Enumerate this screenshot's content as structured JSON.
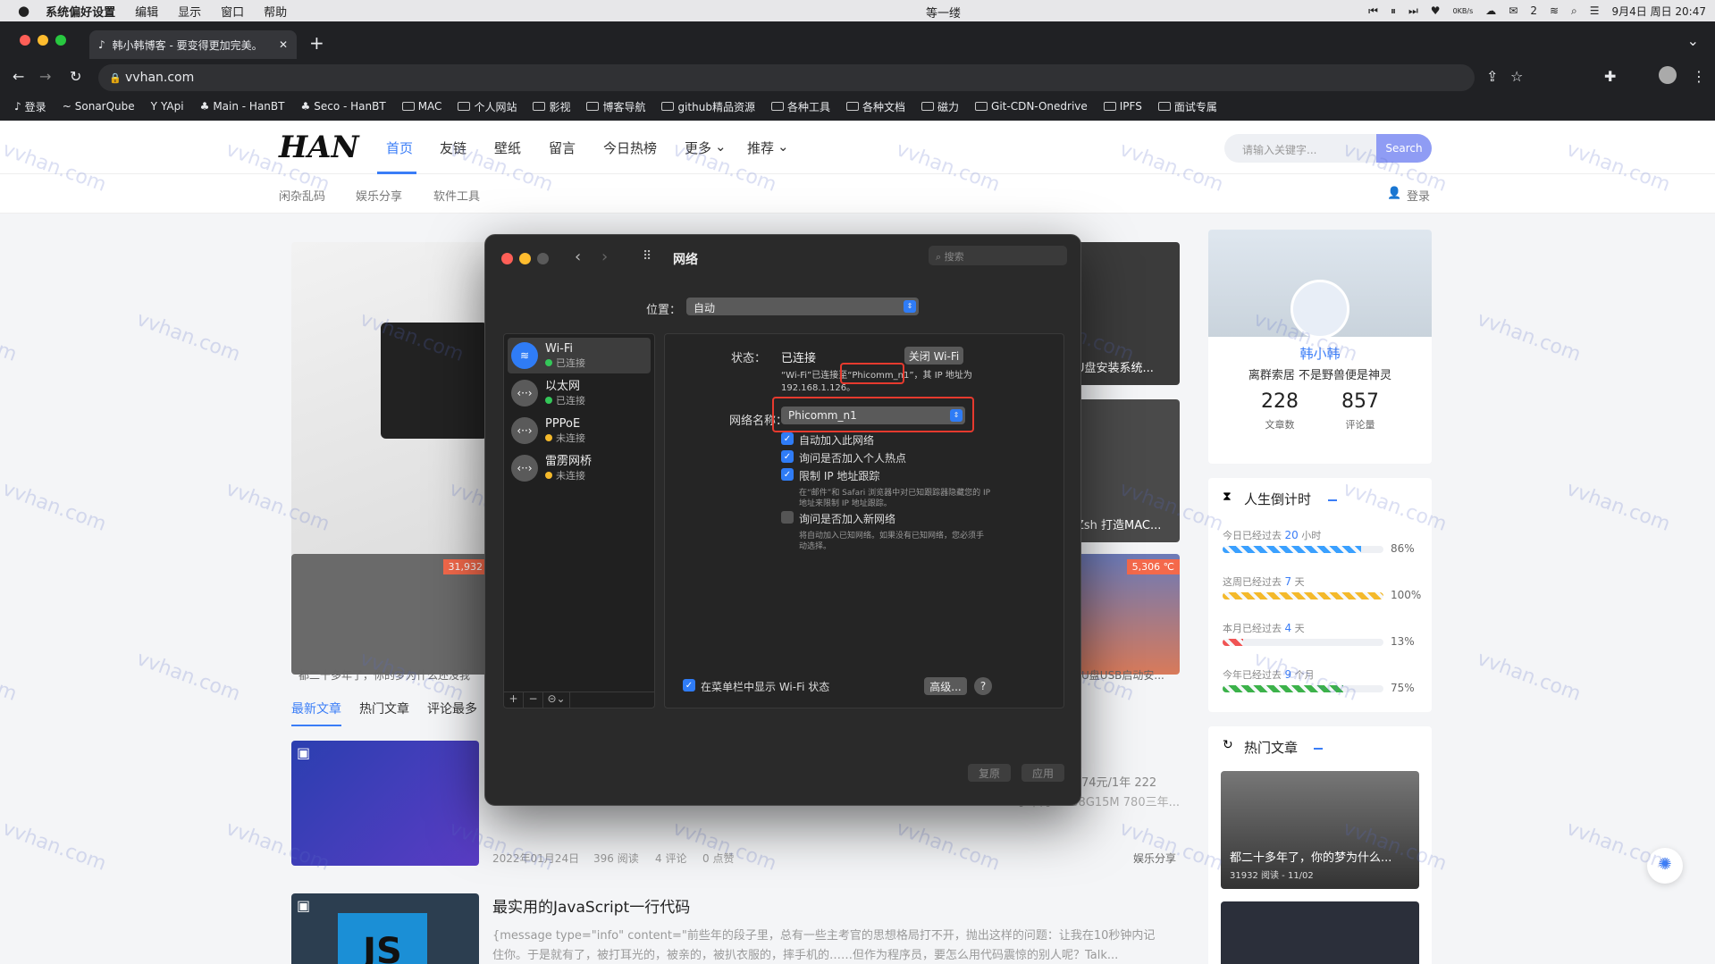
{
  "menubar": {
    "app": "系统偏好设置",
    "items": [
      "编辑",
      "显示",
      "窗口",
      "帮助"
    ],
    "center": "等一缕",
    "clock": "9月4日 周日  20:47",
    "net": "0KB/s",
    "wechat_count": "2"
  },
  "browser": {
    "tab_title": "韩小韩博客 - 要变得更加完美。",
    "url": "vvhan.com",
    "bookmarks": [
      "登录",
      "SonarQube",
      "YApi",
      "Main - HanBT",
      "Seco - HanBT",
      "MAC",
      "个人网站",
      "影视",
      "博客导航",
      "github精品资源",
      "各种工具",
      "各种文档",
      "磁力",
      "Git-CDN-Onedrive",
      "IPFS",
      "面试专属"
    ]
  },
  "site": {
    "logo": "HAN",
    "nav": [
      "首页",
      "友链",
      "壁纸",
      "留言",
      "今日热榜",
      "更多",
      "推荐"
    ],
    "search_placeholder": "请输入关键字...",
    "search_button": "Search",
    "subnav": [
      "闲杂乱码",
      "娱乐分享",
      "软件工具"
    ],
    "login": "登录",
    "cards": {
      "top_right": "U盘安装系统...",
      "mid_right": "Zsh 打造MAC...",
      "bottom_left": "都二十多年了，你的梦为什么还没我",
      "bottom_left_badge": "31,932",
      "bottom_right": "U盘USB启动安...",
      "bottom_right_badge": "5,306 ℃"
    },
    "tabs": [
      "最新文章",
      "热门文章",
      "评论最多"
    ],
    "post1": {
      "meta": "2022年01月24日",
      "reads": "396 阅读",
      "comments": "4 评论",
      "likes": "0 点赞",
      "category": "娱乐分享",
      "snippet": "74元/1年 222",
      "snippet2": "...880+二手华为WEB8G15M 780三年..."
    },
    "post2": {
      "title": "最实用的JavaScript一行代码",
      "snippet": "{message type=\"info\" content=\"前些年的段子里，总有一些主考官的思想格局打不开，抛出这样的问题：让我在10秒钟内记",
      "snippet2": "住你。于是就有了，被打耳光的，被亲的，被扒衣服的，摔手机的……但作为程序员，要怎么用代码震惊的别人呢？Talk..."
    },
    "profile": {
      "name": "韩小韩",
      "motto": "离群索居 不是野兽便是神灵",
      "articles": "228",
      "articles_label": "文章数",
      "comments": "857",
      "comments_label": "评论量"
    },
    "countdown": {
      "title": "人生倒计时",
      "rows": [
        {
          "label": "今日已经过去",
          "num": "20",
          "unit": "小时",
          "pct": "86%",
          "val": 0.86,
          "color": "#3aa0ff"
        },
        {
          "label": "这周已经过去",
          "num": "7",
          "unit": "天",
          "pct": "100%",
          "val": 1.0,
          "color": "#f4b92b"
        },
        {
          "label": "本月已经过去",
          "num": "4",
          "unit": "天",
          "pct": "13%",
          "val": 0.13,
          "color": "#f05454"
        },
        {
          "label": "今年已经过去",
          "num": "9",
          "unit": "个月",
          "pct": "75%",
          "val": 0.75,
          "color": "#3cb24a"
        }
      ]
    },
    "hot": {
      "title": "热门文章",
      "item": "都二十多年了，你的梦为什么...",
      "meta": "31932 阅读 - 11/02"
    }
  },
  "dialog": {
    "title": "网络",
    "search_placeholder": "搜索",
    "location_label": "位置：",
    "location_value": "自动",
    "services": [
      {
        "name": "Wi-Fi",
        "status": "已连接",
        "color": "#34c759"
      },
      {
        "name": "以太网",
        "status": "已连接",
        "color": "#34c759"
      },
      {
        "name": "PPPoE",
        "status": "未连接",
        "color": "#f4b92b"
      },
      {
        "name": "雷雳网桥",
        "status": "未连接",
        "color": "#f4b92b"
      }
    ],
    "status_label": "状态：",
    "status_value": "已连接",
    "wifi_off": "关闭 Wi-Fi",
    "desc1": "“Wi-Fi”已连接至",
    "ssid": "“Phicomm_n1”",
    "desc2": "，其 IP 地址为",
    "desc3": "192.168.1.126。",
    "network_label": "网络名称：",
    "network_value": "Phicomm_n1",
    "checks": [
      {
        "text": "自动加入此网络",
        "on": true
      },
      {
        "text": "询问是否加入个人热点",
        "on": true
      },
      {
        "text": "限制 IP 地址跟踪",
        "on": true
      },
      {
        "text": "询问是否加入新网络",
        "on": false
      }
    ],
    "note1": "在“邮件”和 Safari 浏览器中对已知跟踪器隐藏您的 IP",
    "note1b": "地址来限制 IP 地址跟踪。",
    "note2": "将自动加入已知网络。如果没有已知网络，您必须手",
    "note2b": "动选择。",
    "show_menubar": "在菜单栏中显示 Wi-Fi 状态",
    "advanced": "高级...",
    "help": "?",
    "revert": "复原",
    "apply": "应用"
  },
  "watermark": "vvhan.com"
}
